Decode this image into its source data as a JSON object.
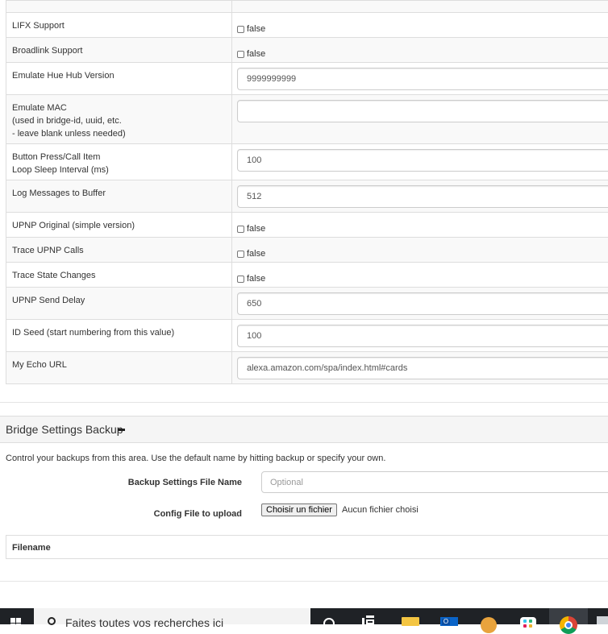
{
  "settings_rows": [
    {
      "label": "LIFX Support",
      "type": "checkbox",
      "value": "false"
    },
    {
      "label": "Broadlink Support",
      "type": "checkbox",
      "value": "false"
    },
    {
      "label": "Emulate Hue Hub Version",
      "type": "text",
      "value": "9999999999"
    },
    {
      "label_lines": [
        "Emulate MAC",
        "(used in bridge-id, uuid, etc.",
        "- leave blank unless needed)"
      ],
      "type": "text",
      "value": ""
    },
    {
      "label_lines": [
        "Button Press/Call Item",
        "Loop Sleep Interval (ms)"
      ],
      "type": "text",
      "value": "100"
    },
    {
      "label": "Log Messages to Buffer",
      "type": "text",
      "value": "512"
    },
    {
      "label": "UPNP Original (simple version)",
      "type": "checkbox",
      "value": "false"
    },
    {
      "label": "Trace UPNP Calls",
      "type": "checkbox",
      "value": "false"
    },
    {
      "label": "Trace State Changes",
      "type": "checkbox",
      "value": "false"
    },
    {
      "label": "UPNP Send Delay",
      "type": "text",
      "value": "650"
    },
    {
      "label": "ID Seed (start numbering from this value)",
      "type": "text",
      "value": "100"
    },
    {
      "label": "My Echo URL",
      "type": "text",
      "value": "alexa.amazon.com/spa/index.html#cards"
    }
  ],
  "backup": {
    "title": "Bridge Settings Backup",
    "help": "Control your backups from this area. Use the default name by hitting backup or specify your own.",
    "file_name_label": "Backup Settings File Name",
    "file_name_placeholder": "Optional",
    "upload_label": "Config File to upload",
    "choose_file_button": "Choisir un fichier",
    "no_file_text": "Aucun fichier choisi",
    "table_header": "Filename"
  },
  "taskbar": {
    "search_text": "Faites toutes vos recherches ici"
  }
}
